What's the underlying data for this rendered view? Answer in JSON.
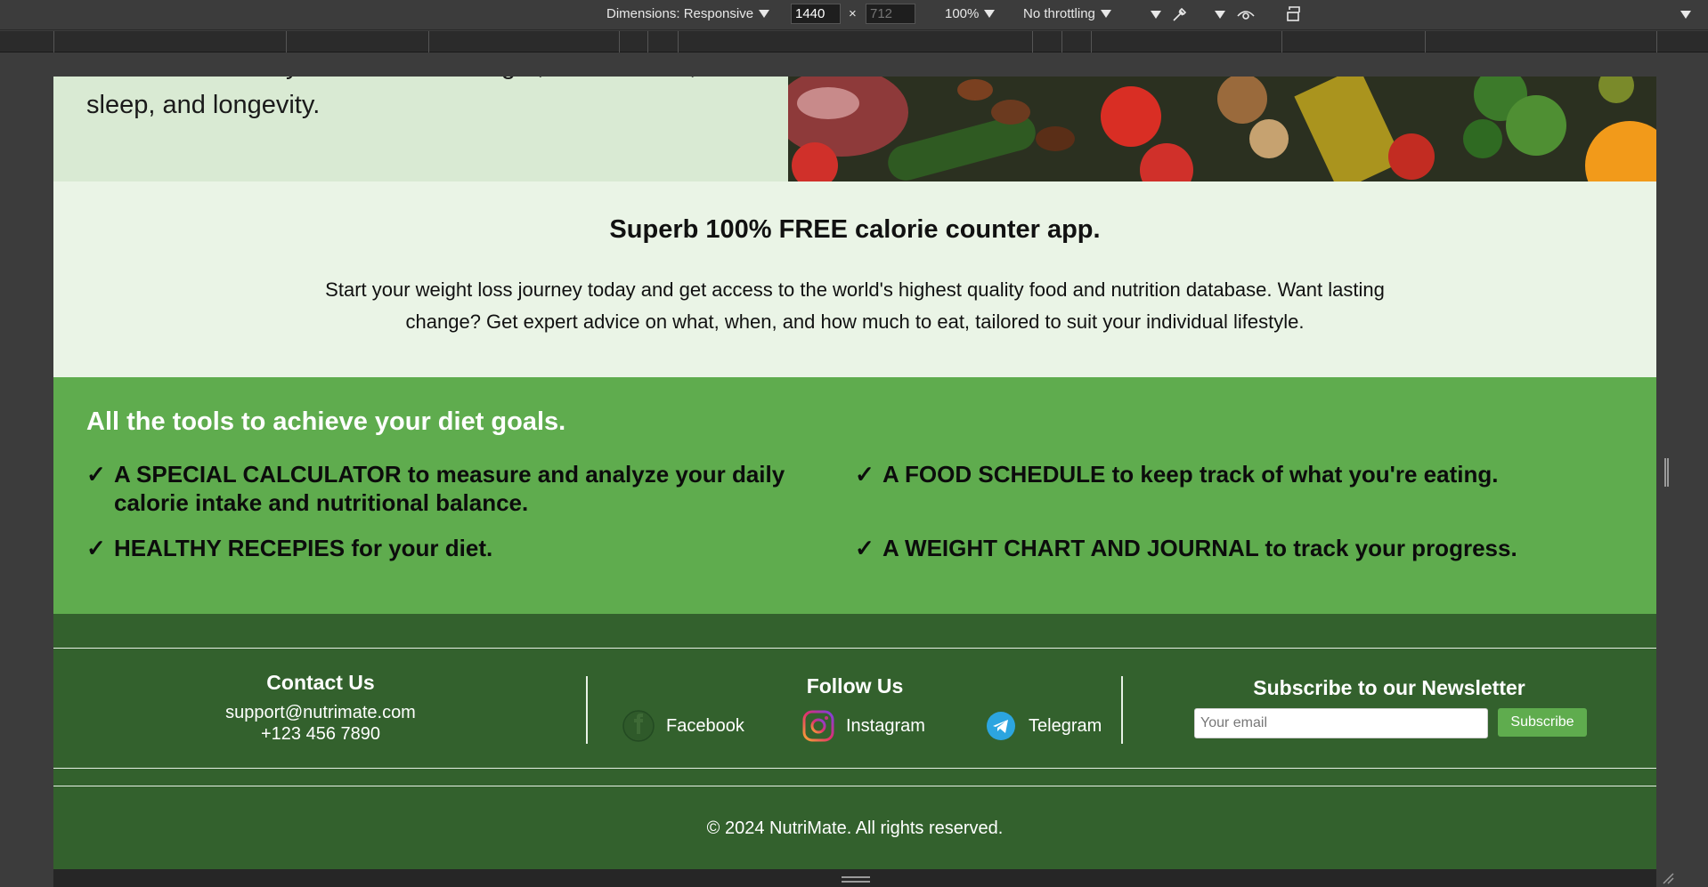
{
  "devtools": {
    "dimensions_label": "Dimensions: Responsive",
    "width_value": "1440",
    "height_placeholder": "712",
    "times_symbol": "×",
    "zoom": "100%",
    "throttling": "No throttling"
  },
  "hero": {
    "text": "Nutrition is the key to a healthier weight, better mood, restful sleep, and longevity."
  },
  "intro": {
    "title": "Superb 100% FREE calorie counter app.",
    "description": "Start your weight loss journey today and get access to the world's highest quality food and nutrition database. Want lasting change? Get expert advice on what, when, and how much to eat, tailored to suit your individual lifestyle."
  },
  "tools": {
    "title": "All the tools to achieve your diet goals.",
    "check": "✓",
    "features": [
      {
        "highlight": "A SPECIAL CALCULATOR",
        "rest": " to measure and analyze your daily calorie intake and nutritional balance."
      },
      {
        "highlight": "A FOOD SCHEDULE",
        "rest": " to keep track of what you're eating."
      },
      {
        "highlight": "HEALTHY RECEPIES",
        "rest": " for your diet."
      },
      {
        "highlight": "A WEIGHT CHART AND JOURNAL",
        "rest": " to track your progress."
      }
    ]
  },
  "footer": {
    "contact": {
      "title": "Contact Us",
      "email": "support@nutrimate.com",
      "phone": "+123 456 7890"
    },
    "follow": {
      "title": "Follow Us",
      "links": [
        {
          "label": "Facebook",
          "icon": "facebook-icon"
        },
        {
          "label": "Instagram",
          "icon": "instagram-icon"
        },
        {
          "label": "Telegram",
          "icon": "telegram-icon"
        }
      ]
    },
    "newsletter": {
      "title": "Subscribe to our Newsletter",
      "placeholder": "Your email",
      "button": "Subscribe"
    },
    "copyright": "© 2024 NutriMate. All rights reserved."
  },
  "colors": {
    "hero_bg": "#d9ead3",
    "intro_bg": "#eaf4e6",
    "tools_bg": "#5fac4e",
    "footer_bg": "#33612d"
  }
}
